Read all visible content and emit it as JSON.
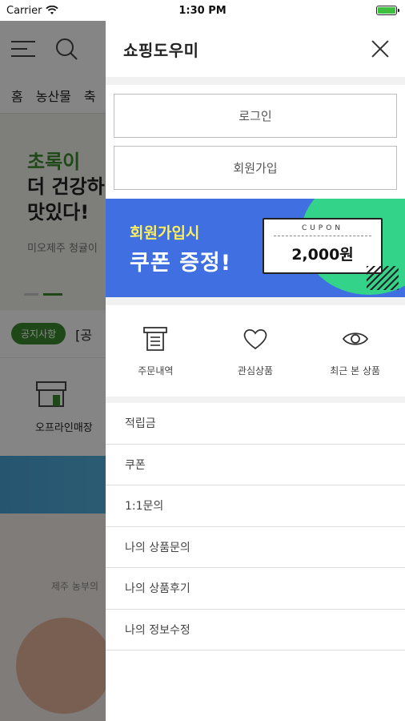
{
  "status_bar": {
    "carrier": "Carrier",
    "time": "1:30 PM"
  },
  "background": {
    "nav_tabs": [
      "홈",
      "농산물",
      "축"
    ],
    "hero": {
      "line1": "초록이",
      "line2": "더 건강하",
      "line3": "맛있다!",
      "sub": "미오제주 청귤이"
    },
    "notice_pill": "공지사항",
    "notice_extra": "[공",
    "store_label": "오프라인매장",
    "bottom_text": "제주 농부의"
  },
  "drawer": {
    "title": "쇼핑도우미",
    "login_label": "로그인",
    "signup_label": "회원가입",
    "coupon": {
      "line1": "회원가입시",
      "line2": "쿠폰 증정!",
      "ticket_label": "CUPON",
      "amount": "2,000원"
    },
    "quick_links": [
      {
        "label": "주문내역",
        "icon": "receipt-icon"
      },
      {
        "label": "관심상품",
        "icon": "heart-icon"
      },
      {
        "label": "최근 본 상품",
        "icon": "eye-icon"
      }
    ],
    "menu_items": [
      "적립금",
      "쿠폰",
      "1:1문의",
      "나의 상품문의",
      "나의 상품후기",
      "나의 정보수정"
    ]
  }
}
